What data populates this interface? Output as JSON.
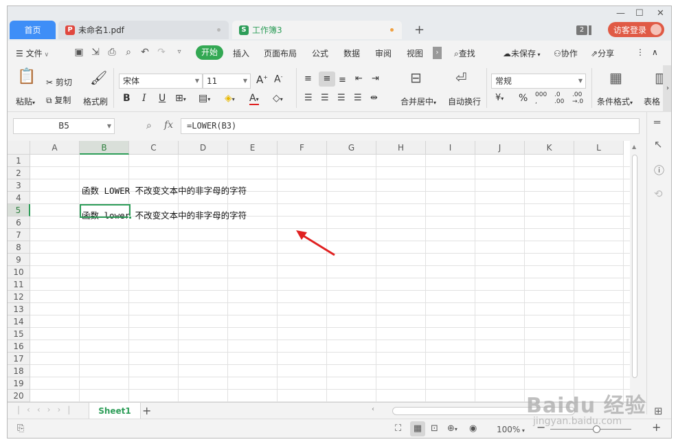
{
  "tabs": {
    "home": "首页",
    "pdf": "未命名1.pdf",
    "workbook": "工作簿3",
    "window_count": "2",
    "login": "访客登录"
  },
  "menu": {
    "file": "文件",
    "items": [
      "开始",
      "插入",
      "页面布局",
      "公式",
      "数据",
      "审阅",
      "视图"
    ],
    "search": "查找",
    "unsaved": "未保存",
    "collab": "协作",
    "share": "分享"
  },
  "ribbon": {
    "paste": "粘贴",
    "cut": "剪切",
    "copy": "复制",
    "format_painter": "格式刷",
    "font_name": "宋体",
    "font_size": "11",
    "merge_center": "合并居中",
    "wrap_text": "自动换行",
    "number_format": "常规",
    "conditional_format": "条件格式",
    "table_style": "表格"
  },
  "formula_bar": {
    "cell_ref": "B5",
    "fx": "fx",
    "formula": "=LOWER(B3)"
  },
  "sheet": {
    "columns": [
      "A",
      "B",
      "C",
      "D",
      "E",
      "F",
      "G",
      "H",
      "I",
      "J",
      "K",
      "L"
    ],
    "selected_column": "B",
    "rows": [
      "1",
      "2",
      "3",
      "4",
      "5",
      "6",
      "7",
      "8",
      "9",
      "10",
      "11",
      "12",
      "13",
      "14",
      "15",
      "16",
      "17",
      "18",
      "19",
      "20"
    ],
    "selected_row": "5",
    "cells": {
      "B3": "函数 LOWER 不改变文本中的非字母的字符",
      "B5": "函数 lower 不改变文本中的非字母的字符"
    }
  },
  "sheet_tabs": {
    "active": "Sheet1"
  },
  "status": {
    "zoom": "100%"
  },
  "watermark": {
    "brand": "Baidu 经验",
    "url": "jingyan.baidu.com"
  },
  "colors": {
    "accent_green": "#2d9d58",
    "home_tab_blue": "#3e8ef7",
    "login_red": "#e05a45",
    "arrow_red": "#e02020"
  }
}
